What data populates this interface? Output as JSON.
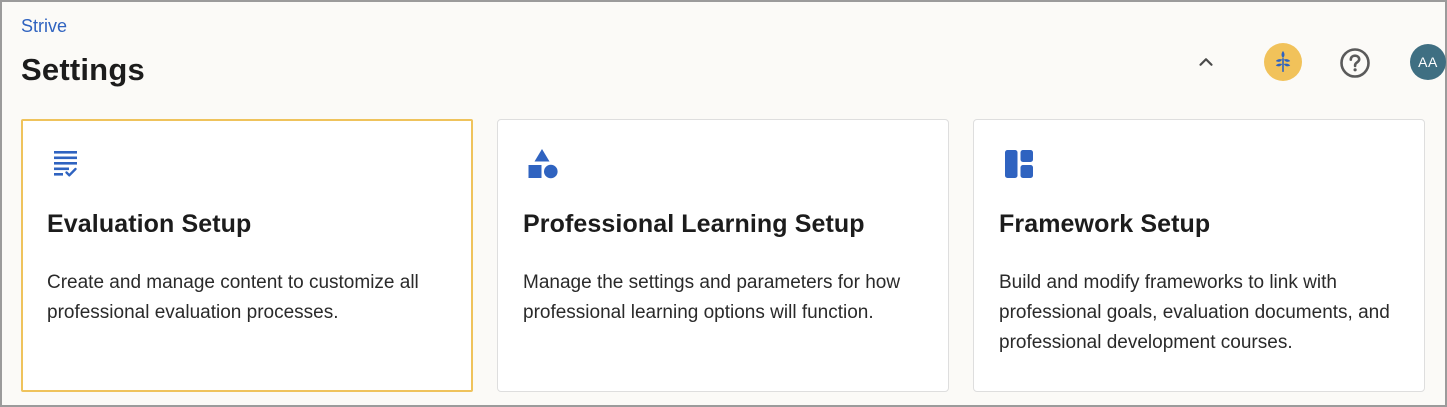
{
  "header": {
    "breadcrumb": "Strive",
    "title": "Settings",
    "actions": {
      "collapse_icon": "chevron-up-icon",
      "brand_icon": "wheat-logo-icon",
      "help_icon": "help-circle-icon",
      "avatar_initials": "AA"
    }
  },
  "colors": {
    "accent_blue": "#2f63c0",
    "selected_border": "#efc35c",
    "brand_badge": "#f1c25a",
    "avatar_bg": "#3f6f82"
  },
  "cards": [
    {
      "icon": "checklist-icon",
      "title": "Evaluation Setup",
      "description": "Create and manage content to customize all professional evaluation processes.",
      "selected": true
    },
    {
      "icon": "shapes-icon",
      "title": "Professional Learning Setup",
      "description": "Manage the settings and parameters for how professional learning options will function.",
      "selected": false
    },
    {
      "icon": "dashboard-layout-icon",
      "title": "Framework Setup",
      "description": "Build and modify frameworks to link with professional goals, evaluation documents, and professional development courses.",
      "selected": false
    }
  ]
}
